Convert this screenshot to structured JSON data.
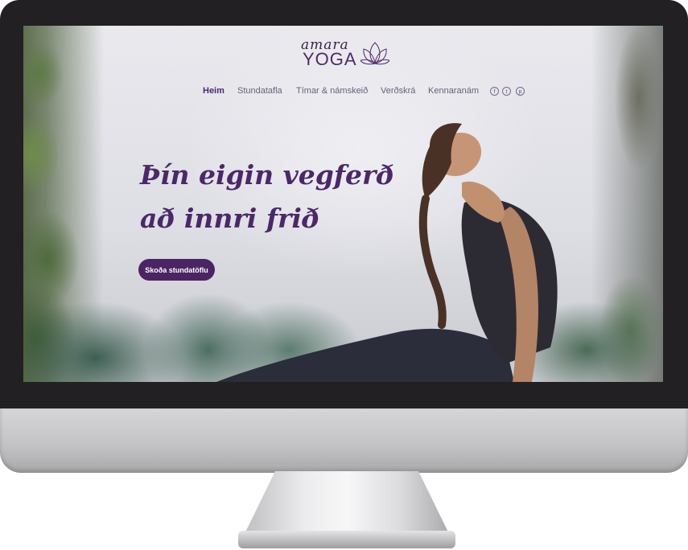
{
  "logo": {
    "script": "amara",
    "word": "YOGA"
  },
  "nav": {
    "items": [
      {
        "label": "Heim",
        "active": true
      },
      {
        "label": "Stundatafla",
        "active": false
      },
      {
        "label": "Tímar & námskeið",
        "active": false
      },
      {
        "label": "Verðskrá",
        "active": false
      },
      {
        "label": "Kennaranám",
        "active": false
      }
    ],
    "social": [
      {
        "icon": "facebook-icon",
        "glyph": "f"
      },
      {
        "icon": "twitter-icon",
        "glyph": "t"
      },
      {
        "icon": "pinterest-icon",
        "glyph": "p"
      }
    ]
  },
  "hero": {
    "line1": "Þín eigin vegferð",
    "line2": "að innri frið",
    "cta": "Skoða stundatöflu"
  },
  "colors": {
    "brand_purple": "#4b2463",
    "nav_text": "#6b5f7a",
    "bezel": "#222022"
  }
}
